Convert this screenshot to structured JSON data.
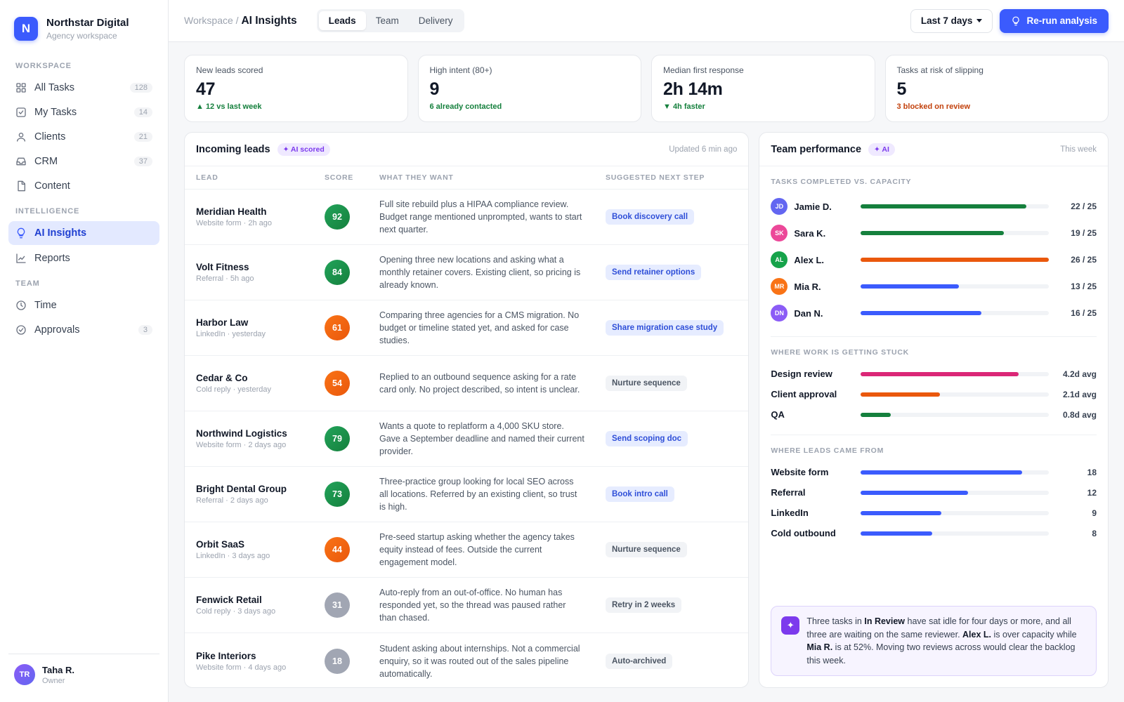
{
  "brand": {
    "initial": "N",
    "name": "Northstar Digital",
    "subtitle": "Agency workspace"
  },
  "sidebar": {
    "groups": [
      {
        "label": "Workspace",
        "items": [
          {
            "label": "All Tasks",
            "count": "128",
            "icon": "grid-icon"
          },
          {
            "label": "My Tasks",
            "count": "14",
            "icon": "check-square-icon"
          },
          {
            "label": "Clients",
            "count": "21",
            "icon": "user-icon"
          },
          {
            "label": "CRM",
            "count": "37",
            "icon": "inbox-icon"
          },
          {
            "label": "Content",
            "count": "",
            "icon": "file-icon"
          }
        ]
      },
      {
        "label": "Intelligence",
        "items": [
          {
            "label": "AI Insights",
            "count": "",
            "icon": "lightbulb-icon",
            "active": true
          },
          {
            "label": "Reports",
            "count": "",
            "icon": "line-chart-icon"
          }
        ]
      },
      {
        "label": "Team",
        "items": [
          {
            "label": "Time",
            "count": "",
            "icon": "clock-icon"
          },
          {
            "label": "Approvals",
            "count": "3",
            "icon": "check-circle-icon"
          }
        ]
      }
    ],
    "user": {
      "initials": "TR",
      "name": "Taha R.",
      "role": "Owner"
    }
  },
  "header": {
    "breadcrumb_root": "Workspace /",
    "breadcrumb_current": "AI Insights",
    "tabs": [
      "Leads",
      "Team",
      "Delivery"
    ],
    "active_tab": "Leads",
    "range_label": "Last 7 days",
    "rerun_label": "Re-run analysis"
  },
  "kpis": [
    {
      "label": "New leads scored",
      "value": "47",
      "delta": "▲ 12 vs last week",
      "tone": "green"
    },
    {
      "label": "High intent (80+)",
      "value": "9",
      "delta": "6 already contacted",
      "tone": "green"
    },
    {
      "label": "Median first response",
      "value": "2h 14m",
      "delta": "▼ 4h faster",
      "tone": "green"
    },
    {
      "label": "Tasks at risk of slipping",
      "value": "5",
      "delta": "3 blocked on review",
      "tone": "orange"
    }
  ],
  "leads": {
    "title": "Incoming leads",
    "badge": "✦ AI scored",
    "updated": "Updated 6 min ago",
    "columns": [
      "LEAD",
      "SCORE",
      "WHAT THEY WANT",
      "SUGGESTED NEXT STEP"
    ],
    "rows": [
      {
        "name": "Meridian Health",
        "source": "Website form · 2h ago",
        "score": "92",
        "tone": "green",
        "want": "Full site rebuild plus a HIPAA compliance review. Budget range mentioned unprompted, wants to start next quarter.",
        "next": "Book discovery call",
        "next_tone": "blue"
      },
      {
        "name": "Volt Fitness",
        "source": "Referral · 5h ago",
        "score": "84",
        "tone": "green",
        "want": "Opening three new locations and asking what a monthly retainer covers. Existing client, so pricing is already known.",
        "next": "Send retainer options",
        "next_tone": "blue"
      },
      {
        "name": "Harbor Law",
        "source": "LinkedIn · yesterday",
        "score": "61",
        "tone": "orange",
        "want": "Comparing three agencies for a CMS migration. No budget or timeline stated yet, and asked for case studies.",
        "next": "Share migration case study",
        "next_tone": "blue"
      },
      {
        "name": "Cedar & Co",
        "source": "Cold reply · yesterday",
        "score": "54",
        "tone": "orange",
        "want": "Replied to an outbound sequence asking for a rate card only. No project described, so intent is unclear.",
        "next": "Nurture sequence",
        "next_tone": "grey"
      },
      {
        "name": "Northwind Logistics",
        "source": "Website form · 2 days ago",
        "score": "79",
        "tone": "green",
        "want": "Wants a quote to replatform a 4,000 SKU store. Gave a September deadline and named their current provider.",
        "next": "Send scoping doc",
        "next_tone": "blue"
      },
      {
        "name": "Bright Dental Group",
        "source": "Referral · 2 days ago",
        "score": "73",
        "tone": "green",
        "want": "Three-practice group looking for local SEO across all locations. Referred by an existing client, so trust is high.",
        "next": "Book intro call",
        "next_tone": "blue"
      },
      {
        "name": "Orbit SaaS",
        "source": "LinkedIn · 3 days ago",
        "score": "44",
        "tone": "orange",
        "want": "Pre-seed startup asking whether the agency takes equity instead of fees. Outside the current engagement model.",
        "next": "Nurture sequence",
        "next_tone": "grey"
      },
      {
        "name": "Fenwick Retail",
        "source": "Cold reply · 3 days ago",
        "score": "31",
        "tone": "grey",
        "want": "Auto-reply from an out-of-office. No human has responded yet, so the thread was paused rather than chased.",
        "next": "Retry in 2 weeks",
        "next_tone": "grey"
      },
      {
        "name": "Pike Interiors",
        "source": "Website form · 4 days ago",
        "score": "18",
        "tone": "grey",
        "want": "Student asking about internships. Not a commercial enquiry, so it was routed out of the sales pipeline automatically.",
        "next": "Auto-archived",
        "next_tone": "grey"
      }
    ]
  },
  "performance": {
    "title": "Team performance",
    "badge": "✦ AI",
    "period": "This week",
    "capacity_title": "Tasks completed vs. capacity",
    "capacity": [
      {
        "initials": "JD",
        "name": "Jamie D.",
        "done": 22,
        "cap": 25,
        "value": "22 / 25",
        "color": "#15803d",
        "avatar": "#6366f1"
      },
      {
        "initials": "SK",
        "name": "Sara K.",
        "done": 19,
        "cap": 25,
        "value": "19 / 25",
        "color": "#15803d",
        "avatar": "#ec4899"
      },
      {
        "initials": "AL",
        "name": "Alex L.",
        "done": 26,
        "cap": 25,
        "value": "26 / 25",
        "color": "#ea580c",
        "avatar": "#16a34a"
      },
      {
        "initials": "MR",
        "name": "Mia R.",
        "done": 13,
        "cap": 25,
        "value": "13 / 25",
        "color": "#3b5bfd",
        "avatar": "#f97316"
      },
      {
        "initials": "DN",
        "name": "Dan N.",
        "done": 16,
        "cap": 25,
        "value": "16 / 25",
        "color": "#3b5bfd",
        "avatar": "#8b5cf6"
      }
    ],
    "stuck_title": "Where work is getting stuck",
    "stuck": [
      {
        "name": "Design review",
        "days": 4.2,
        "value": "4.2d avg",
        "color": "#db2777"
      },
      {
        "name": "Client approval",
        "days": 2.1,
        "value": "2.1d avg",
        "color": "#ea580c"
      },
      {
        "name": "QA",
        "days": 0.8,
        "value": "0.8d avg",
        "color": "#15803d"
      }
    ],
    "sources_title": "Where leads came from",
    "sources": [
      {
        "name": "Website form",
        "count": 18,
        "value": "18"
      },
      {
        "name": "Referral",
        "count": 12,
        "value": "12"
      },
      {
        "name": "LinkedIn",
        "count": 9,
        "value": "9"
      },
      {
        "name": "Cold outbound",
        "count": 8,
        "value": "8"
      }
    ],
    "insight": {
      "t1": "Three tasks in ",
      "b1": "In Review",
      "t2": " have sat idle for four days or more, and all three are waiting on the same reviewer. ",
      "b2": "Alex L.",
      "t3": " is over capacity while ",
      "b3": "Mia R.",
      "t4": " is at 52%. Moving two reviews across would clear the backlog this week."
    }
  },
  "colors": {
    "accent": "#3b5bfd",
    "green": "#15803d",
    "orange": "#ea580c",
    "ai": "#7c3aed"
  }
}
